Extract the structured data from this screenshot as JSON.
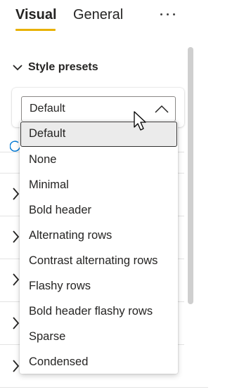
{
  "tabs": [
    {
      "label": "Visual",
      "active": true
    },
    {
      "label": "General",
      "active": false
    }
  ],
  "more_icon": "more-horizontal-icon",
  "section": {
    "title": "Style presets",
    "expanded": true,
    "select": {
      "value": "Default",
      "open": true
    }
  },
  "dropdown": {
    "options": [
      "Default",
      "None",
      "Minimal",
      "Bold header",
      "Alternating rows",
      "Contrast alternating rows",
      "Flashy rows",
      "Bold header flashy rows",
      "Sparse",
      "Condensed"
    ],
    "selected_index": 0
  },
  "colors": {
    "accent": "#e8b100",
    "text": "#252423",
    "reset_icon": "#0078d4"
  }
}
